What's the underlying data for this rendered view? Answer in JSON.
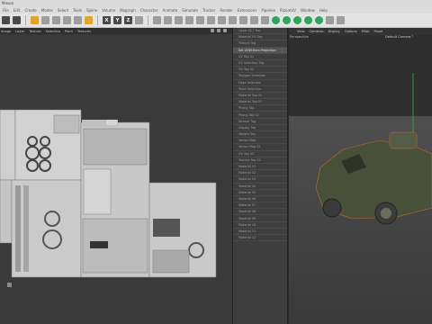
{
  "app": {
    "title": "Maxon"
  },
  "menubar": {
    "items": [
      "File",
      "Edit",
      "Create",
      "Modes",
      "Select",
      "Tools",
      "Spline",
      "Volume",
      "Mograph",
      "Character",
      "Animate",
      "Simulate",
      "Tracker",
      "Render",
      "Extensions",
      "Pipeline",
      "RizomUV",
      "Window",
      "Help"
    ]
  },
  "toolbar": {
    "axis_x": "X",
    "axis_y": "Y",
    "axis_z": "Z"
  },
  "uv_editor": {
    "menu": [
      "Image",
      "Layer",
      "Texture",
      "Selection",
      "Paint",
      "Textures"
    ],
    "colors": {
      "background": "#3a3a3a",
      "islands": "#cfcfcf",
      "outline": "#777777"
    }
  },
  "layers": {
    "items": [
      "Layer 01 / Top",
      "Material UV Tag",
      "Texture Tag",
      "Set UVW from Projection",
      "UV Tag 01",
      "UV Selection Tag",
      "UV Tag 02",
      "Polygon Selection",
      "Edge Selection",
      "Point Selection",
      "Material Tag 01",
      "Material Tag 02",
      "Phong Tag",
      "Phong Tag 02",
      "Normal Tag",
      "Display Tag",
      "Weight Tag",
      "Vertex Map",
      "Vertex Map 02",
      "UV Tag 03",
      "Texture Tag 02",
      "Material 01",
      "Material 02",
      "Material 03",
      "Material 04",
      "Material 05",
      "Material 06",
      "Material 07",
      "Material 08",
      "Material 09",
      "Material 10",
      "Material 11",
      "Material 12"
    ],
    "selected_index": 3
  },
  "viewport": {
    "menu": [
      "View",
      "Cameras",
      "Display",
      "Options",
      "Filter",
      "Panel"
    ],
    "name": "Perspective",
    "camera": "Default Camera °",
    "colors": {
      "vehicle": "#48503a",
      "selection": "#c46a2a"
    }
  }
}
